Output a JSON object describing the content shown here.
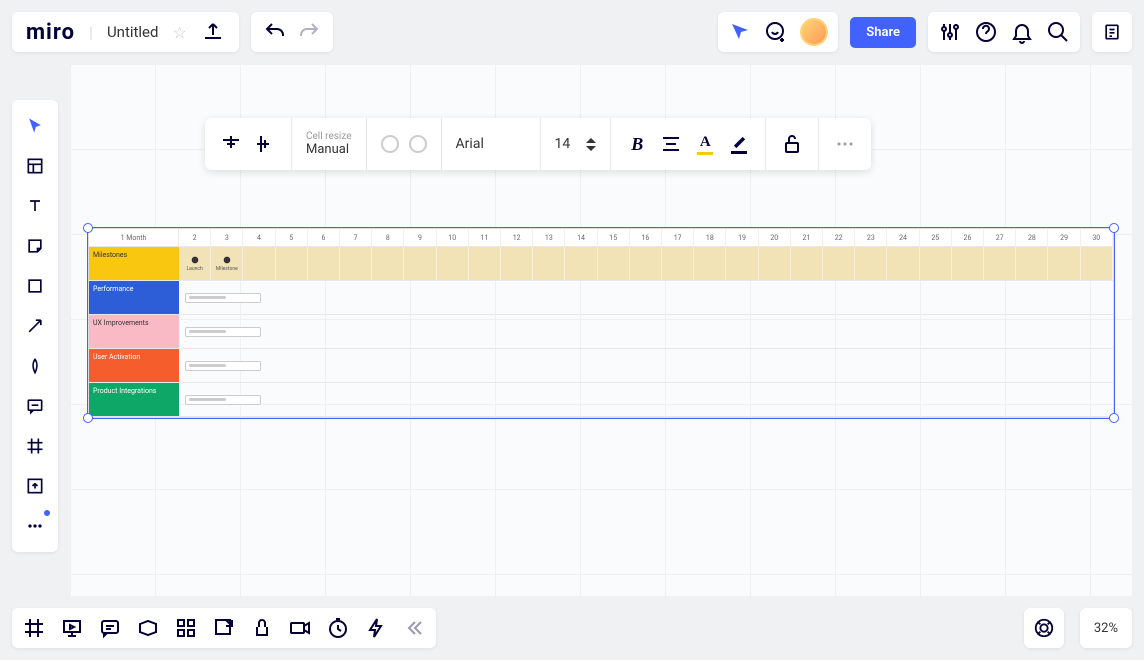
{
  "app": {
    "logo": "miro",
    "title": "Untitled"
  },
  "toolbar": {
    "share_label": "Share"
  },
  "context": {
    "cell_resize_label": "Cell resize",
    "cell_resize_value": "Manual",
    "font_family": "Arial",
    "font_size": "14"
  },
  "roadmap": {
    "month_label": "1 Month",
    "days": [
      "2",
      "3",
      "4",
      "5",
      "6",
      "7",
      "8",
      "9",
      "10",
      "11",
      "12",
      "13",
      "14",
      "15",
      "16",
      "17",
      "18",
      "19",
      "20",
      "21",
      "22",
      "23",
      "24",
      "25",
      "26",
      "27",
      "28",
      "29",
      "30"
    ],
    "rows": [
      {
        "label": "Milestones",
        "type": "milestones",
        "milestones": [
          {
            "name": "Launch",
            "icon": "rocket"
          },
          {
            "name": "Milestone",
            "icon": "target"
          }
        ]
      },
      {
        "label": "Performance",
        "type": "performance"
      },
      {
        "label": "UX Improvements",
        "type": "ux"
      },
      {
        "label": "User Activation",
        "type": "activation"
      },
      {
        "label": "Product Integrations",
        "type": "integrations"
      }
    ]
  },
  "zoom": {
    "level": "32%"
  }
}
